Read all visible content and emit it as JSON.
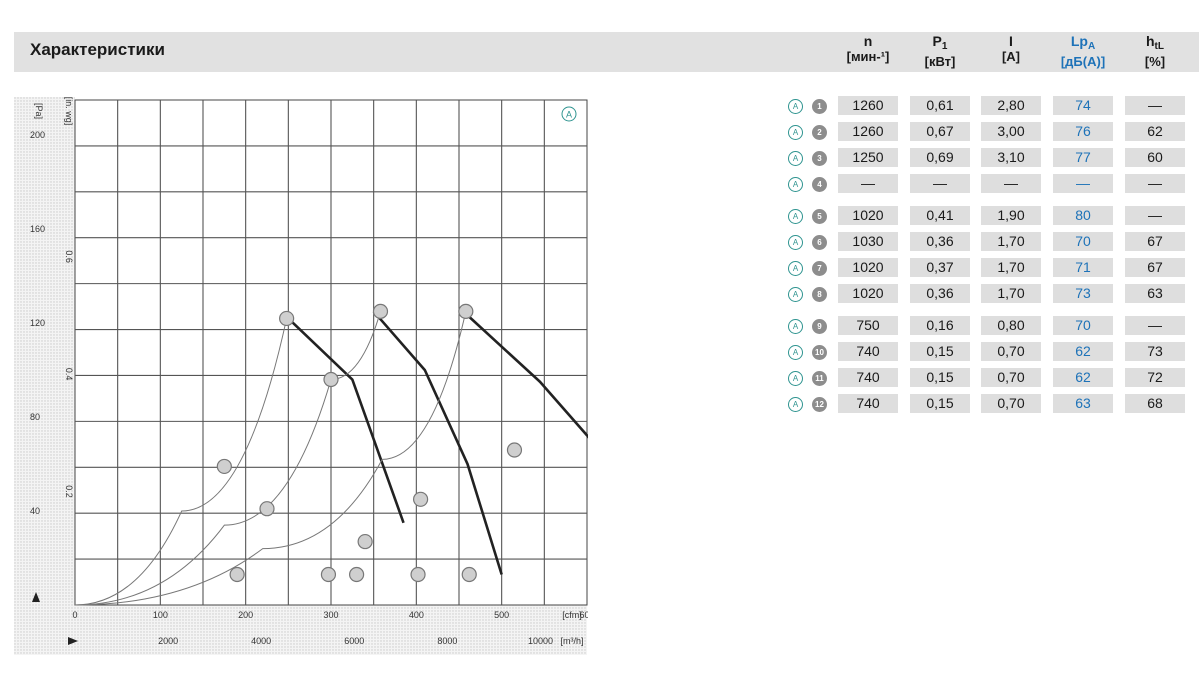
{
  "header": {
    "title": "Характеристики",
    "columns": [
      {
        "main": "n",
        "sub": "",
        "unit": "[мин-¹]",
        "accent": false
      },
      {
        "main": "P",
        "sub": "1",
        "unit": "[кВт]",
        "accent": false
      },
      {
        "main": "I",
        "sub": "",
        "unit": "[A]",
        "accent": false
      },
      {
        "main": "Lp",
        "sub": "A",
        "unit": "[дБ(A)]",
        "accent": true
      },
      {
        "main": "h",
        "sub": "tL",
        "unit": "[%]",
        "accent": false
      }
    ]
  },
  "rows": [
    {
      "mark": "A",
      "num": "1",
      "n": "1260",
      "p": "0,61",
      "i": "2,80",
      "lp": "74",
      "h": "—"
    },
    {
      "mark": "A",
      "num": "2",
      "n": "1260",
      "p": "0,67",
      "i": "3,00",
      "lp": "76",
      "h": "62"
    },
    {
      "mark": "A",
      "num": "3",
      "n": "1250",
      "p": "0,69",
      "i": "3,10",
      "lp": "77",
      "h": "60"
    },
    {
      "mark": "A",
      "num": "4",
      "n": "—",
      "p": "—",
      "i": "—",
      "lp": "—",
      "h": "—"
    },
    {
      "mark": "A",
      "num": "5",
      "n": "1020",
      "p": "0,41",
      "i": "1,90",
      "lp": "80",
      "h": "—"
    },
    {
      "mark": "A",
      "num": "6",
      "n": "1030",
      "p": "0,36",
      "i": "1,70",
      "lp": "70",
      "h": "67"
    },
    {
      "mark": "A",
      "num": "7",
      "n": "1020",
      "p": "0,37",
      "i": "1,70",
      "lp": "71",
      "h": "67"
    },
    {
      "mark": "A",
      "num": "8",
      "n": "1020",
      "p": "0,36",
      "i": "1,70",
      "lp": "73",
      "h": "63"
    },
    {
      "mark": "A",
      "num": "9",
      "n": "750",
      "p": "0,16",
      "i": "0,80",
      "lp": "70",
      "h": "—"
    },
    {
      "mark": "A",
      "num": "10",
      "n": "740",
      "p": "0,15",
      "i": "0,70",
      "lp": "62",
      "h": "73"
    },
    {
      "mark": "A",
      "num": "11",
      "n": "740",
      "p": "0,15",
      "i": "0,70",
      "lp": "62",
      "h": "72"
    },
    {
      "mark": "A",
      "num": "12",
      "n": "740",
      "p": "0,15",
      "i": "0,70",
      "lp": "63",
      "h": "68"
    }
  ],
  "chart_data": {
    "type": "line",
    "corner_label": "A",
    "x_ticks_top": [
      "0",
      "100",
      "200",
      "300",
      "400",
      "500",
      "600"
    ],
    "x_unit_top": "[cfm]",
    "x_ticks_bottom": [
      "2000",
      "4000",
      "6000",
      "8000",
      "10000"
    ],
    "x_unit_bottom": "[m³/h]",
    "y_ticks": [
      "200",
      "160",
      "120",
      "80",
      "40"
    ],
    "y_unit": "[Pa]",
    "y2_ticks": [
      "0.6",
      "0.4",
      "0.2"
    ],
    "y2_unit": "[in. wg]",
    "xlim": [
      0,
      600
    ],
    "ylim": [
      0,
      215
    ],
    "grid": true,
    "series": [
      {
        "kind": "fan",
        "x": [
          250,
          325,
          385
        ],
        "y": [
          122,
          96,
          35
        ]
      },
      {
        "kind": "fan",
        "x": [
          350,
          410,
          460,
          500
        ],
        "y": [
          125,
          100,
          60,
          13
        ]
      },
      {
        "kind": "fan",
        "x": [
          455,
          545,
          615,
          635
        ],
        "y": [
          125,
          95,
          66,
          13
        ]
      },
      {
        "kind": "system",
        "x": [
          0,
          125,
          248
        ],
        "y": [
          0,
          40,
          122
        ]
      },
      {
        "kind": "system",
        "x": [
          0,
          175,
          300,
          358
        ],
        "y": [
          0,
          34,
          96,
          125
        ]
      },
      {
        "kind": "system",
        "x": [
          0,
          220,
          360,
          458
        ],
        "y": [
          0,
          24,
          62,
          125
        ]
      }
    ],
    "points": [
      {
        "x": 248,
        "y": 122
      },
      {
        "x": 175,
        "y": 59
      },
      {
        "x": 358,
        "y": 125
      },
      {
        "x": 300,
        "y": 96
      },
      {
        "x": 225,
        "y": 41
      },
      {
        "x": 190,
        "y": 13
      },
      {
        "x": 458,
        "y": 125
      },
      {
        "x": 515,
        "y": 66
      },
      {
        "x": 405,
        "y": 45
      },
      {
        "x": 340,
        "y": 27
      },
      {
        "x": 297,
        "y": 13
      },
      {
        "x": 330,
        "y": 13
      },
      {
        "x": 402,
        "y": 13
      },
      {
        "x": 462,
        "y": 13
      }
    ]
  }
}
